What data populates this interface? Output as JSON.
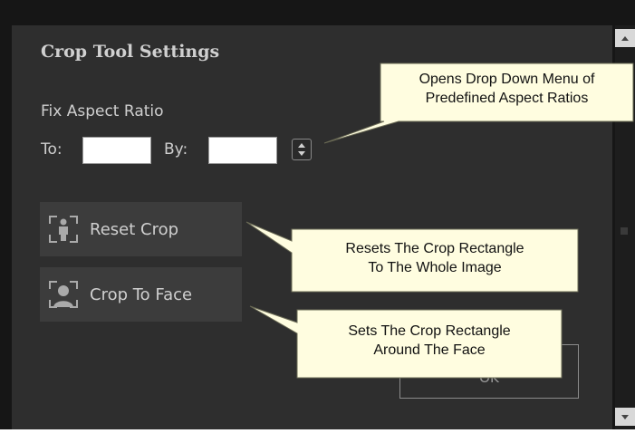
{
  "panel": {
    "title": "Crop Tool Settings",
    "fix_aspect_label": "Fix Aspect Ratio",
    "to_label": "To:",
    "by_label": "By:",
    "to_value": "",
    "by_value": ""
  },
  "buttons": {
    "reset_crop": "Reset Crop",
    "crop_to_face": "Crop To Face",
    "ok": "OK"
  },
  "callouts": {
    "aspect_line1": "Opens Drop Down Menu of",
    "aspect_line2": "Predefined Aspect Ratios",
    "reset_line1": "Resets The Crop Rectangle",
    "reset_line2": "To The Whole Image",
    "face_line1": "Sets The Crop Rectangle",
    "face_line2": "Around The Face"
  },
  "icons": {
    "stepper": "up-down-arrows-icon",
    "reset_crop": "crop-person-icon",
    "crop_to_face": "crop-face-icon",
    "scroll_up": "arrow-up-icon",
    "scroll_down": "arrow-down-icon"
  },
  "colors": {
    "frame": "#161616",
    "panel": "#2e2e2e",
    "button": "#3c3c3c",
    "text": "#cfcfcf",
    "callout_fill": "#fffde0"
  }
}
